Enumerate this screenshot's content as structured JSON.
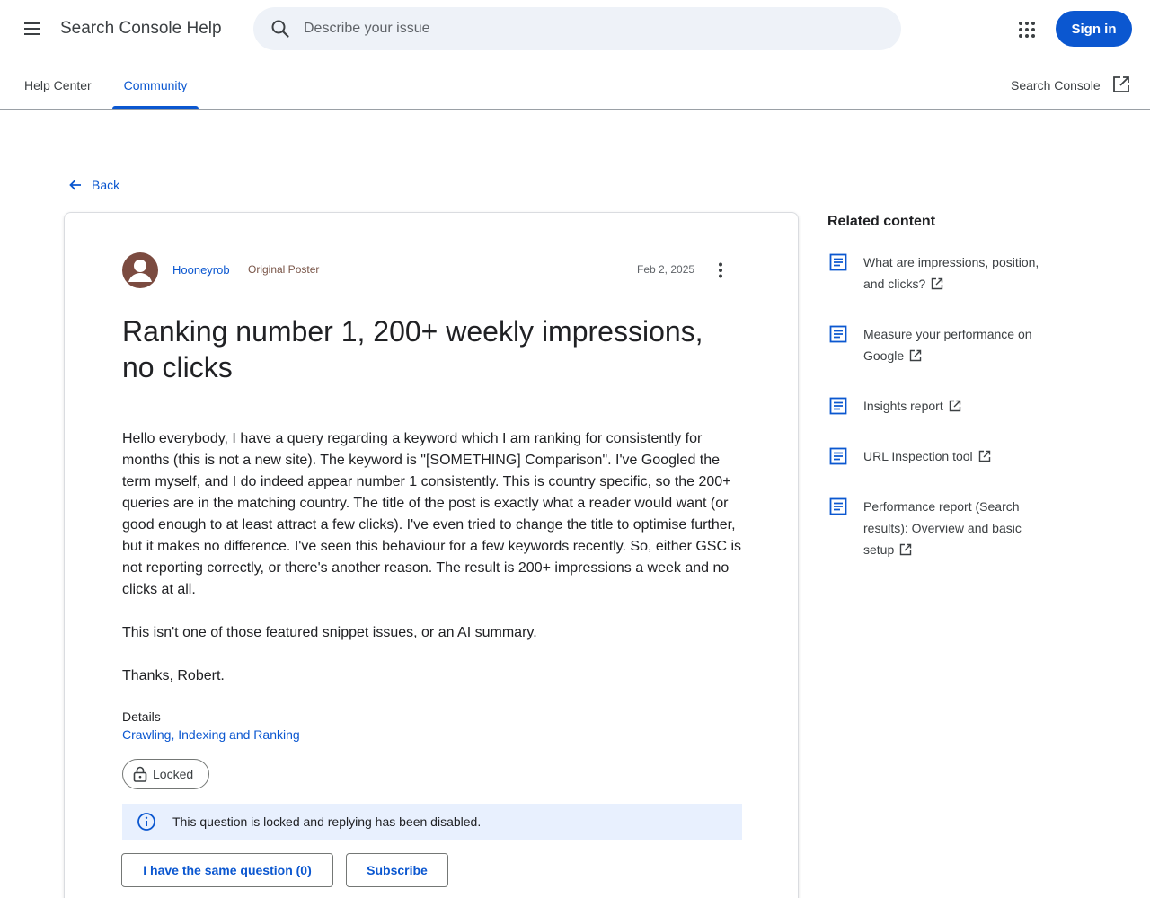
{
  "header": {
    "product_name": "Search Console Help",
    "search_placeholder": "Describe your issue",
    "signin_label": "Sign in"
  },
  "tabs": {
    "help_center": "Help Center",
    "community": "Community",
    "search_console_link": "Search Console"
  },
  "back_label": "Back",
  "post": {
    "author": "Hooneyrob",
    "badge": "Original Poster",
    "date": "Feb 2, 2025",
    "title": "Ranking number 1, 200+ weekly impressions, no clicks",
    "paragraphs": [
      "Hello everybody, I have a query regarding a keyword which I am ranking for consistently for months (this is not a new site). The keyword is \"[SOMETHING] Comparison\". I've Googled the term myself, and I do indeed appear number 1 consistently. This is country specific, so the 200+ queries are in the matching country. The title of the post is exactly what a reader would want (or good enough to at least attract a few clicks). I've even tried to change the title to optimise further, but it makes no difference. I've seen this behaviour for a few keywords recently. So, either GSC is not reporting correctly, or there's another reason. The result is 200+ impressions a week and no clicks at all.",
      "This isn't one of those featured snippet issues, or an AI summary.",
      "Thanks, Robert."
    ],
    "details_label": "Details",
    "details_category": "Crawling, Indexing and Ranking",
    "locked_label": "Locked",
    "locked_notice": "This question is locked and replying has been disabled.",
    "same_question_label": "I have the same question (0)",
    "subscribe_label": "Subscribe"
  },
  "related": {
    "title": "Related content",
    "items": [
      {
        "label": "What are impressions, position, and clicks?"
      },
      {
        "label": "Measure your performance on Google"
      },
      {
        "label": "Insights report"
      },
      {
        "label": "URL Inspection tool"
      },
      {
        "label": "Performance report (Search results): Overview and basic setup"
      }
    ]
  },
  "colors": {
    "accent": "#0b57d0",
    "notice_bg": "#e8f0fe",
    "search_bg": "#eef2f8",
    "badge": "#795548"
  },
  "icons": [
    "menu-icon",
    "search-icon",
    "apps-icon",
    "external-link-icon",
    "arrow-back-icon",
    "more-vert-icon",
    "lock-icon",
    "info-icon",
    "document-icon"
  ]
}
